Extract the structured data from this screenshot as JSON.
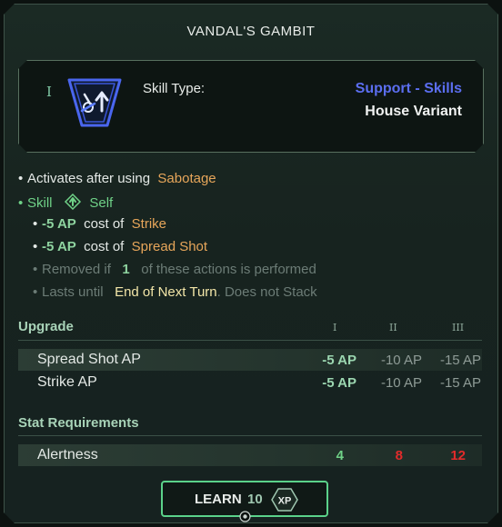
{
  "tooltip": {
    "title": "VANDAL'S GAMBIT",
    "tier": "I",
    "icon": "sabotage-gear-arrow-icon",
    "skill_type_label": "Skill Type:",
    "skill_category": "Support - Skills",
    "skill_variant": "House Variant",
    "colors": {
      "accent_green": "#5bd28a",
      "category_blue": "#5b6ef0",
      "highlight_orange": "#e7a65a",
      "warning_red": "#e12b2b"
    }
  },
  "effects": {
    "activates_prefix": "Activates after using",
    "activates_skill": "Sabotage",
    "target_type": "Skill",
    "target_icon": "self-target-arrow-icon",
    "target": "Self",
    "cost_lines": [
      {
        "value": "-5 AP",
        "text": "cost of",
        "skill": "Strike"
      },
      {
        "value": "-5 AP",
        "text": "cost of",
        "skill": "Spread Shot"
      }
    ],
    "removed_prefix": "Removed if",
    "removed_count": "1",
    "removed_suffix": "of these actions is performed",
    "lasts_prefix": "Lasts until",
    "lasts_value": "End of Next Turn",
    "lasts_suffix": ". Does not Stack"
  },
  "upgrade": {
    "label": "Upgrade",
    "tiers": [
      "I",
      "II",
      "III"
    ],
    "rows": [
      {
        "name": "Spread Shot AP",
        "values": [
          "-5 AP",
          "-10 AP",
          "-15 AP"
        ]
      },
      {
        "name": "Strike AP",
        "values": [
          "-5 AP",
          "-10 AP",
          "-15 AP"
        ]
      }
    ]
  },
  "requirements": {
    "label": "Stat Requirements",
    "rows": [
      {
        "name": "Alertness",
        "values": [
          "4",
          "8",
          "12"
        ]
      }
    ]
  },
  "learn": {
    "label": "LEARN",
    "cost": "10",
    "unit": "XP"
  }
}
